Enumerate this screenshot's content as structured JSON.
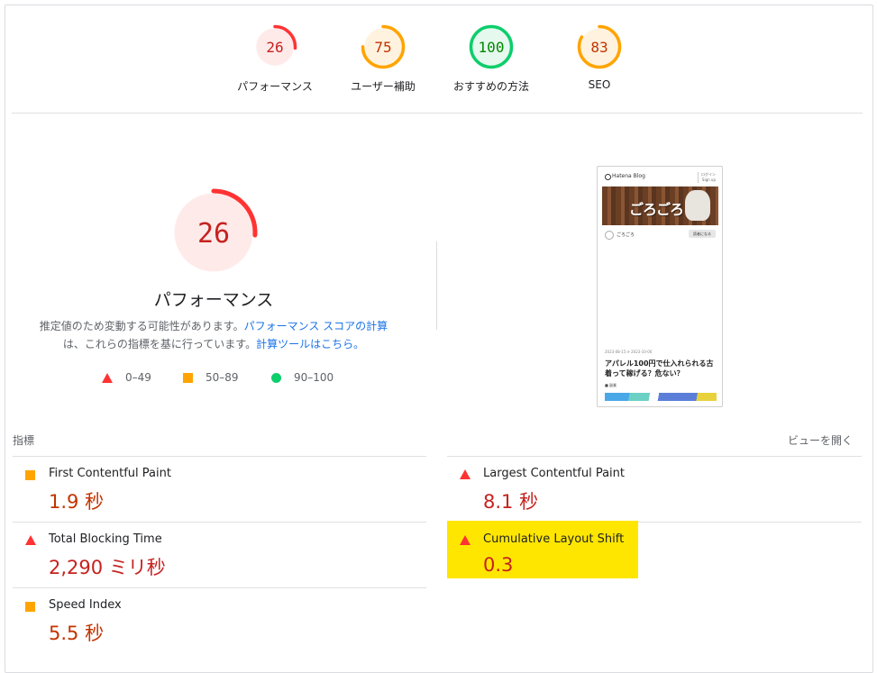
{
  "top_scores": [
    {
      "score": "26",
      "label": "パフォーマンス",
      "fraction": 0.26,
      "status": "fail"
    },
    {
      "score": "75",
      "label": "ユーザー補助",
      "fraction": 0.75,
      "status": "average"
    },
    {
      "score": "100",
      "label": "おすすめの方法",
      "fraction": 1.0,
      "status": "pass"
    },
    {
      "score": "83",
      "label": "SEO",
      "fraction": 0.83,
      "status": "average"
    }
  ],
  "main": {
    "score": "26",
    "fraction": 0.26,
    "title": "パフォーマンス",
    "desc_1": "推定値のため変動する可能性があります。",
    "link_1": "パフォーマンス スコアの計算",
    "desc_2": "は、これらの指標を基に行っています。",
    "link_2": "計算ツールはこちら。"
  },
  "legend": [
    {
      "range": "0–49",
      "shape": "triangle"
    },
    {
      "range": "50–89",
      "shape": "square"
    },
    {
      "range": "90–100",
      "shape": "circle"
    }
  ],
  "thumbnail": {
    "site": "Hatena Blog",
    "login": "ログイン",
    "signup": "Sign up",
    "banner": "ごろごろ",
    "author": "ごろごろ",
    "reader_btn": "読者になる",
    "date": "2023-08-15  ⟳ 2023-10-06",
    "article_title": "アパレル100円で仕入れられる古着って稼げる？危ない？",
    "tag": "■ 副業"
  },
  "metrics_header": "指標",
  "expand_view": "ビューを開く",
  "metrics": [
    {
      "name": "First Contentful Paint",
      "value": "1.9 秒",
      "status": "average"
    },
    {
      "name": "Largest Contentful Paint",
      "value": "8.1 秒",
      "status": "fail"
    },
    {
      "name": "Total Blocking Time",
      "value": "2,290 ミリ秒",
      "status": "fail"
    },
    {
      "name": "Cumulative Layout Shift",
      "value": "0.3",
      "status": "fail",
      "highlighted": true
    },
    {
      "name": "Speed Index",
      "value": "5.5 秒",
      "status": "average"
    }
  ],
  "colors": {
    "fail": "#ff3333",
    "fail_bg": "#ffeaea",
    "fail_text": "#c5221f",
    "average": "#ffa400",
    "average_bg": "#fff3e0",
    "average_text": "#c33300",
    "pass": "#0cce6b",
    "pass_bg": "#e6f9ef",
    "pass_text": "#008800",
    "highlight": "#ffe600"
  }
}
